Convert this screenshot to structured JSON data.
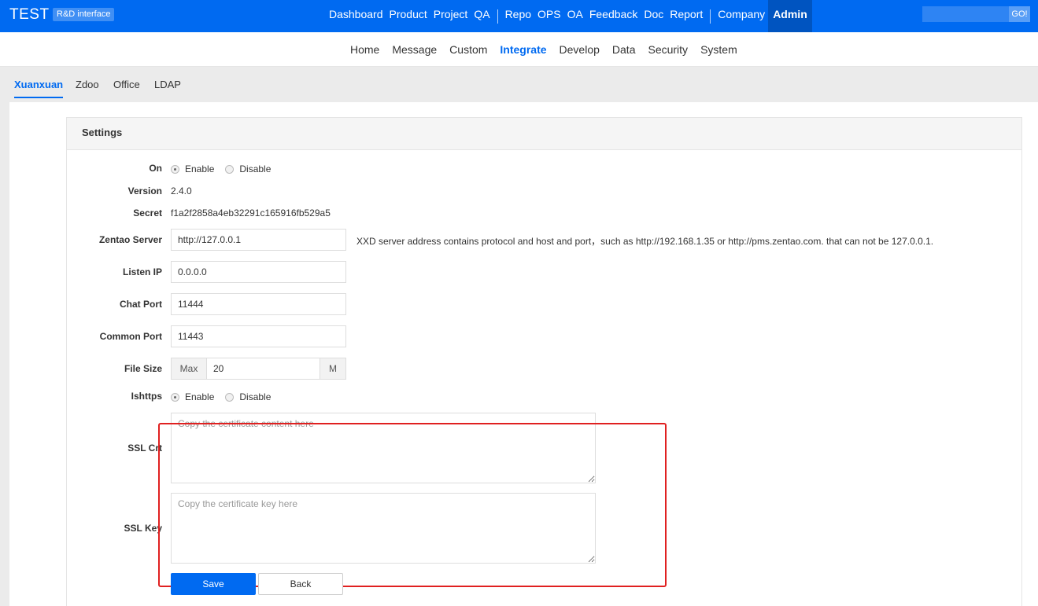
{
  "header": {
    "brand": "TEST",
    "badge": "R&D interface",
    "nav": [
      {
        "label": "Dashboard"
      },
      {
        "label": "Product"
      },
      {
        "label": "Project"
      },
      {
        "label": "QA"
      },
      {
        "label": "Repo"
      },
      {
        "label": "OPS"
      },
      {
        "label": "OA"
      },
      {
        "label": "Feedback"
      },
      {
        "label": "Doc"
      },
      {
        "label": "Report"
      },
      {
        "label": "Company"
      },
      {
        "label": "Admin"
      }
    ],
    "search_button": "GO!"
  },
  "subnav": [
    {
      "label": "Home"
    },
    {
      "label": "Message"
    },
    {
      "label": "Custom"
    },
    {
      "label": "Integrate",
      "active": true
    },
    {
      "label": "Develop"
    },
    {
      "label": "Data"
    },
    {
      "label": "Security"
    },
    {
      "label": "System"
    }
  ],
  "tabs": [
    {
      "label": "Xuanxuan",
      "active": true
    },
    {
      "label": "Zdoo"
    },
    {
      "label": "Office"
    },
    {
      "label": "LDAP"
    }
  ],
  "panel": {
    "title": "Settings",
    "on": {
      "label": "On",
      "options": [
        "Enable",
        "Disable"
      ],
      "selected": "Enable"
    },
    "version": {
      "label": "Version",
      "value": "2.4.0"
    },
    "secret": {
      "label": "Secret",
      "value": "f1a2f2858a4eb32291c165916fb529a5"
    },
    "zentao_server": {
      "label": "Zentao Server",
      "value": "http://127.0.0.1",
      "help": "XXD server address contains protocol and host and port，such as http://192.168.1.35 or http://pms.zentao.com. that can not be 127.0.0.1."
    },
    "listen_ip": {
      "label": "Listen IP",
      "value": "0.0.0.0"
    },
    "chat_port": {
      "label": "Chat Port",
      "value": "11444"
    },
    "common_port": {
      "label": "Common Port",
      "value": "11443"
    },
    "file_size": {
      "label": "File Size",
      "prefix": "Max",
      "value": "20",
      "suffix": "M"
    },
    "ishttps": {
      "label": "Ishttps",
      "options": [
        "Enable",
        "Disable"
      ],
      "selected": "Enable"
    },
    "ssl_crt": {
      "label": "SSL Crt",
      "placeholder": "Copy the certificate content here"
    },
    "ssl_key": {
      "label": "SSL Key",
      "placeholder": "Copy the certificate key here"
    },
    "save_label": "Save",
    "back_label": "Back"
  },
  "colors": {
    "primary": "#006af1",
    "highlight": "#e02020"
  }
}
